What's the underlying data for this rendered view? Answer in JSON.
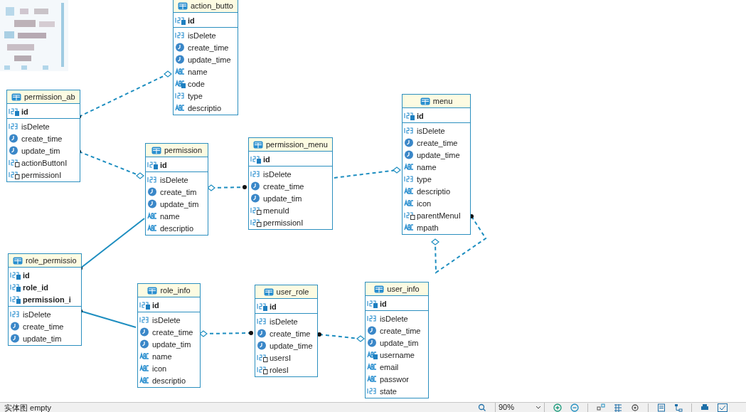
{
  "entities": [
    {
      "name": "action_butto",
      "keys": [
        {
          "name": "id",
          "kind": "pk"
        }
      ],
      "columns": [
        {
          "name": "isDelete",
          "kind": "number"
        },
        {
          "name": "create_time",
          "kind": "datetime"
        },
        {
          "name": "update_time",
          "kind": "datetime"
        },
        {
          "name": "name",
          "kind": "text"
        },
        {
          "name": "code",
          "kind": "text_key"
        },
        {
          "name": "type",
          "kind": "number"
        },
        {
          "name": "descriptio",
          "kind": "text"
        }
      ]
    },
    {
      "name": "permission_ab",
      "keys": [
        {
          "name": "id",
          "kind": "pk"
        }
      ],
      "columns": [
        {
          "name": "isDelete",
          "kind": "number"
        },
        {
          "name": "create_time",
          "kind": "datetime"
        },
        {
          "name": "update_tim",
          "kind": "datetime"
        },
        {
          "name": "actionButtonI",
          "kind": "fk"
        },
        {
          "name": "permissionI",
          "kind": "fk"
        }
      ]
    },
    {
      "name": "permission",
      "keys": [
        {
          "name": "id",
          "kind": "pk"
        }
      ],
      "columns": [
        {
          "name": "isDelete",
          "kind": "number"
        },
        {
          "name": "create_tim",
          "kind": "datetime"
        },
        {
          "name": "update_tim",
          "kind": "datetime"
        },
        {
          "name": "name",
          "kind": "text"
        },
        {
          "name": "descriptio",
          "kind": "text"
        }
      ]
    },
    {
      "name": "permission_menu",
      "keys": [
        {
          "name": "id",
          "kind": "pk"
        }
      ],
      "columns": [
        {
          "name": "isDelete",
          "kind": "number"
        },
        {
          "name": "create_time",
          "kind": "datetime"
        },
        {
          "name": "update_tim",
          "kind": "datetime"
        },
        {
          "name": "menuId",
          "kind": "fk"
        },
        {
          "name": "permissionI",
          "kind": "fk"
        }
      ]
    },
    {
      "name": "menu",
      "keys": [
        {
          "name": "id",
          "kind": "pk"
        }
      ],
      "columns": [
        {
          "name": "isDelete",
          "kind": "number"
        },
        {
          "name": "create_time",
          "kind": "datetime"
        },
        {
          "name": "update_time",
          "kind": "datetime"
        },
        {
          "name": "name",
          "kind": "text"
        },
        {
          "name": "type",
          "kind": "number"
        },
        {
          "name": "descriptio",
          "kind": "text"
        },
        {
          "name": "icon",
          "kind": "text"
        },
        {
          "name": "parentMenuI",
          "kind": "fk"
        },
        {
          "name": "mpath",
          "kind": "text"
        }
      ]
    },
    {
      "name": "role_permissio",
      "keys": [
        {
          "name": "id",
          "kind": "pk"
        },
        {
          "name": "role_id",
          "kind": "pk"
        },
        {
          "name": "permission_i",
          "kind": "pk"
        }
      ],
      "columns": [
        {
          "name": "isDelete",
          "kind": "number"
        },
        {
          "name": "create_time",
          "kind": "datetime"
        },
        {
          "name": "update_tim",
          "kind": "datetime"
        }
      ]
    },
    {
      "name": "role_info",
      "keys": [
        {
          "name": "id",
          "kind": "pk"
        }
      ],
      "columns": [
        {
          "name": "isDelete",
          "kind": "number"
        },
        {
          "name": "create_time",
          "kind": "datetime"
        },
        {
          "name": "update_tim",
          "kind": "datetime"
        },
        {
          "name": "name",
          "kind": "text"
        },
        {
          "name": "icon",
          "kind": "text"
        },
        {
          "name": "descriptio",
          "kind": "text"
        }
      ]
    },
    {
      "name": "user_role",
      "keys": [
        {
          "name": "id",
          "kind": "pk"
        }
      ],
      "columns": [
        {
          "name": "isDelete",
          "kind": "number"
        },
        {
          "name": "create_time",
          "kind": "datetime"
        },
        {
          "name": "update_time",
          "kind": "datetime"
        },
        {
          "name": "usersI",
          "kind": "fk"
        },
        {
          "name": "rolesI",
          "kind": "fk"
        }
      ]
    },
    {
      "name": "user_info",
      "keys": [
        {
          "name": "id",
          "kind": "pk"
        }
      ],
      "columns": [
        {
          "name": "isDelete",
          "kind": "number"
        },
        {
          "name": "create_time",
          "kind": "datetime"
        },
        {
          "name": "update_tim",
          "kind": "datetime"
        },
        {
          "name": "username",
          "kind": "text_key"
        },
        {
          "name": "email",
          "kind": "text"
        },
        {
          "name": "passwor",
          "kind": "text"
        },
        {
          "name": "state",
          "kind": "number"
        }
      ]
    }
  ],
  "status_bar": {
    "diagram_label": "实体图 empty",
    "zoom": "90%"
  }
}
